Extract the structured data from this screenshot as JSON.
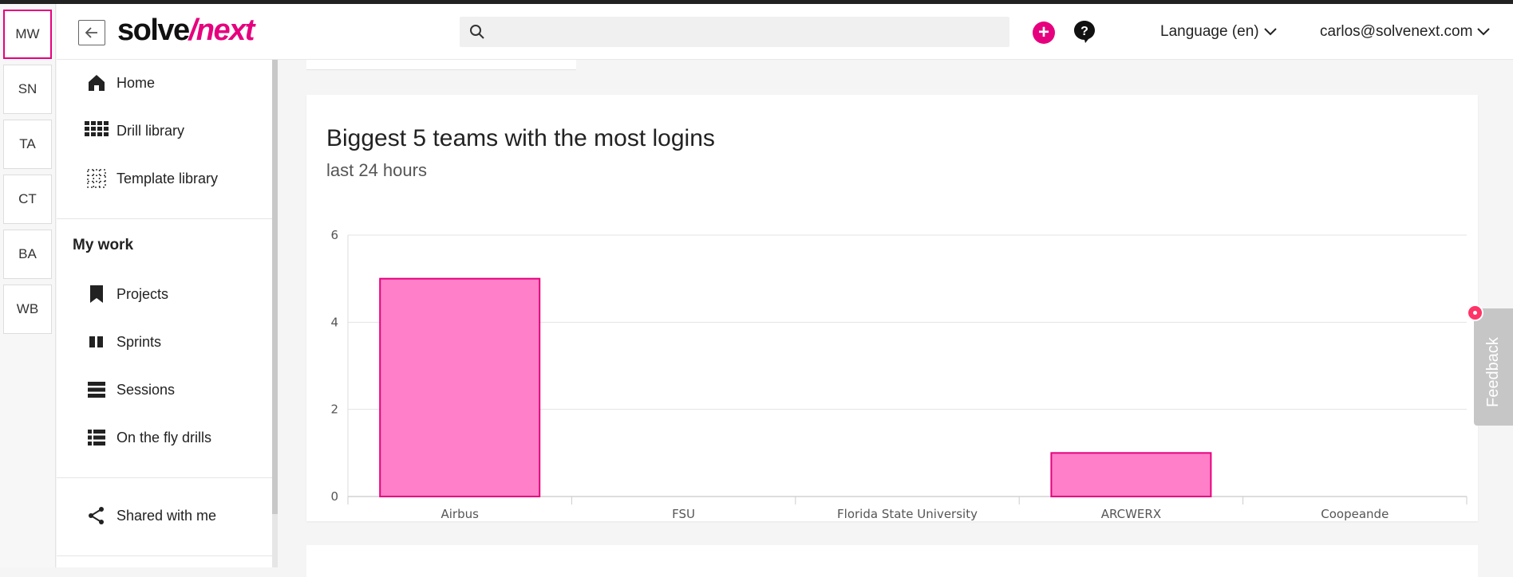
{
  "workspaces": [
    "MW",
    "SN",
    "TA",
    "CT",
    "BA",
    "WB"
  ],
  "header": {
    "logo_a": "solve",
    "logo_slash": "/",
    "logo_b": "next",
    "search_placeholder": "",
    "language": "Language (en)",
    "user_email": "carlos@solvenext.com"
  },
  "sidebar": {
    "items": [
      {
        "label": "Home",
        "icon": "home-icon"
      },
      {
        "label": "Drill library",
        "icon": "grid-icon"
      },
      {
        "label": "Template library",
        "icon": "dotted-grid-icon"
      }
    ],
    "section_title": "My work",
    "work_items": [
      {
        "label": "Projects",
        "icon": "bookmark-icon"
      },
      {
        "label": "Sprints",
        "icon": "columns-icon"
      },
      {
        "label": "Sessions",
        "icon": "rows-icon"
      },
      {
        "label": "On the fly drills",
        "icon": "list-icon"
      }
    ],
    "shared": {
      "label": "Shared with me",
      "icon": "share-icon"
    }
  },
  "card": {
    "title": "Biggest 5 teams with the most logins",
    "subtitle": "last 24 hours"
  },
  "chart_data": {
    "type": "bar",
    "title": "Biggest 5 teams with the most logins",
    "subtitle": "last 24 hours",
    "categories": [
      "Airbus",
      "FSU",
      "Florida State University",
      "ARCWERX",
      "Coopeande"
    ],
    "values": [
      5,
      0,
      0,
      1,
      0
    ],
    "ylim": [
      0,
      6
    ],
    "yticks": [
      0,
      2,
      4,
      6
    ],
    "grid": true,
    "bar_color": "#ff80c8",
    "bar_border": "#e6007e"
  },
  "feedback": {
    "label": "Feedback"
  },
  "colors": {
    "accent": "#e6007e"
  }
}
